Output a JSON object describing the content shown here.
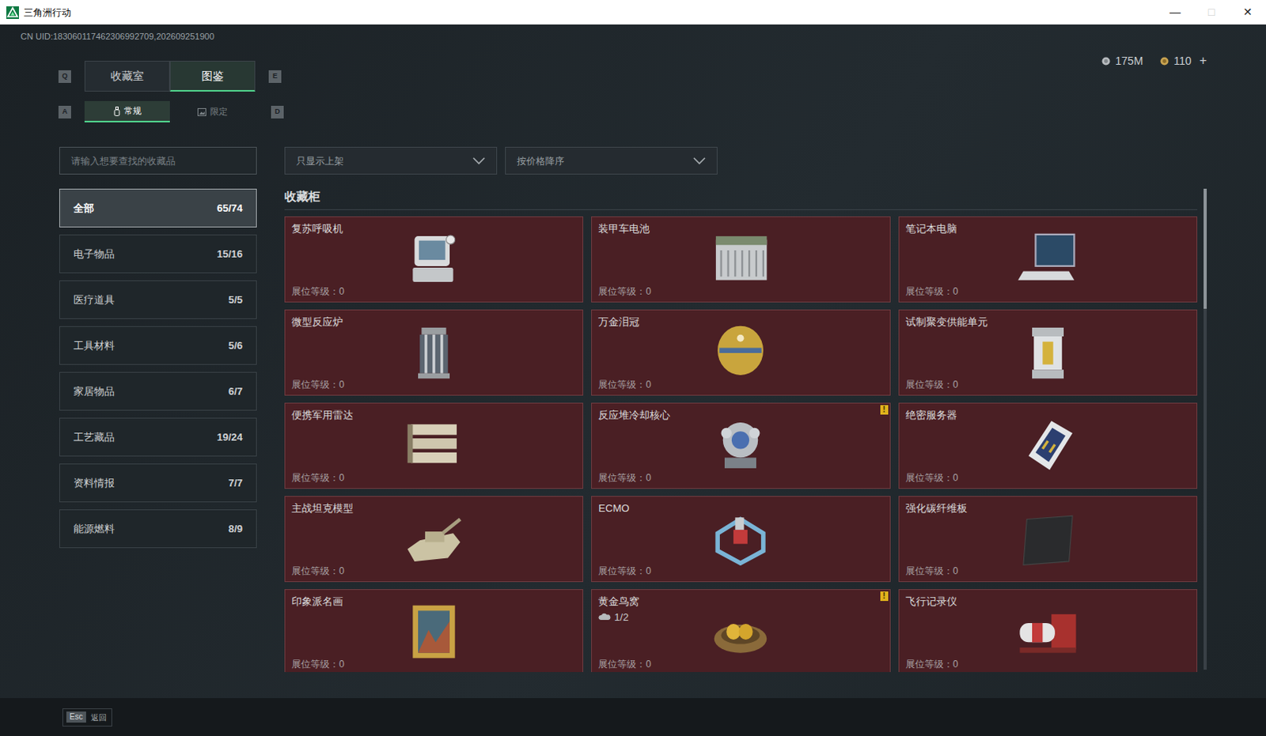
{
  "window": {
    "title": "三角洲行动",
    "controls": [
      {
        "label": "—",
        "disabled": false
      },
      {
        "label": "□",
        "disabled": true
      },
      {
        "label": "✕",
        "disabled": false
      }
    ]
  },
  "uid": "CN UID:183060117462306992709,202609251900",
  "currency": [
    {
      "amount": "175M"
    },
    {
      "amount": "110",
      "action": "+"
    }
  ],
  "tabs": {
    "prev_key": "Q",
    "next_key": "E",
    "items": [
      {
        "label": "收藏室",
        "selected": false
      },
      {
        "label": "图鉴",
        "selected": true
      }
    ]
  },
  "subtabs": {
    "prev_key": "A",
    "next_key": "D",
    "items": [
      {
        "label": "常规",
        "selected": true
      },
      {
        "label": "限定",
        "selected": false
      }
    ]
  },
  "search": {
    "placeholder": "请输入想要查找的收藏品"
  },
  "filters": [
    {
      "value": "只显示上架"
    },
    {
      "value": "按价格降序"
    }
  ],
  "categories": [
    {
      "label": "全部",
      "count": "65/74",
      "selected": true
    },
    {
      "label": "电子物品",
      "count": "15/16",
      "selected": false
    },
    {
      "label": "医疗道具",
      "count": "5/5",
      "selected": false
    },
    {
      "label": "工具材料",
      "count": "5/6",
      "selected": false
    },
    {
      "label": "家居物品",
      "count": "6/7",
      "selected": false
    },
    {
      "label": "工艺藏品",
      "count": "19/24",
      "selected": false
    },
    {
      "label": "资料情报",
      "count": "7/7",
      "selected": false
    },
    {
      "label": "能源燃料",
      "count": "8/9",
      "selected": false
    }
  ],
  "section_title": "收藏柜",
  "items": [
    {
      "name": "复苏呼吸机",
      "level": "展位等级：0"
    },
    {
      "name": "装甲车电池",
      "level": "展位等级：0"
    },
    {
      "name": "笔记本电脑",
      "level": "展位等级：0"
    },
    {
      "name": "微型反应炉",
      "level": "展位等级：0"
    },
    {
      "name": "万金泪冠",
      "level": "展位等级：0"
    },
    {
      "name": "试制聚变供能单元",
      "level": "展位等级：0"
    },
    {
      "name": "便携军用雷达",
      "level": "展位等级：0"
    },
    {
      "name": "反应堆冷却核心",
      "level": "展位等级：0",
      "badge": "!"
    },
    {
      "name": "绝密服务器",
      "level": "展位等级：0"
    },
    {
      "name": "主战坦克模型",
      "level": "展位等级：0"
    },
    {
      "name": "ECMO",
      "level": "展位等级：0"
    },
    {
      "name": "强化碳纤维板",
      "level": "展位等级：0"
    },
    {
      "name": "印象派名画",
      "level": "展位等级：0"
    },
    {
      "name": "黄金鸟窝",
      "level": "展位等级：0",
      "badge": "!",
      "count": "1/2"
    },
    {
      "name": "飞行记录仪",
      "level": "展位等级：0"
    }
  ],
  "scrollbar": {
    "level": 0.25
  },
  "footer": {
    "key": "Esc",
    "label": "返回"
  }
}
